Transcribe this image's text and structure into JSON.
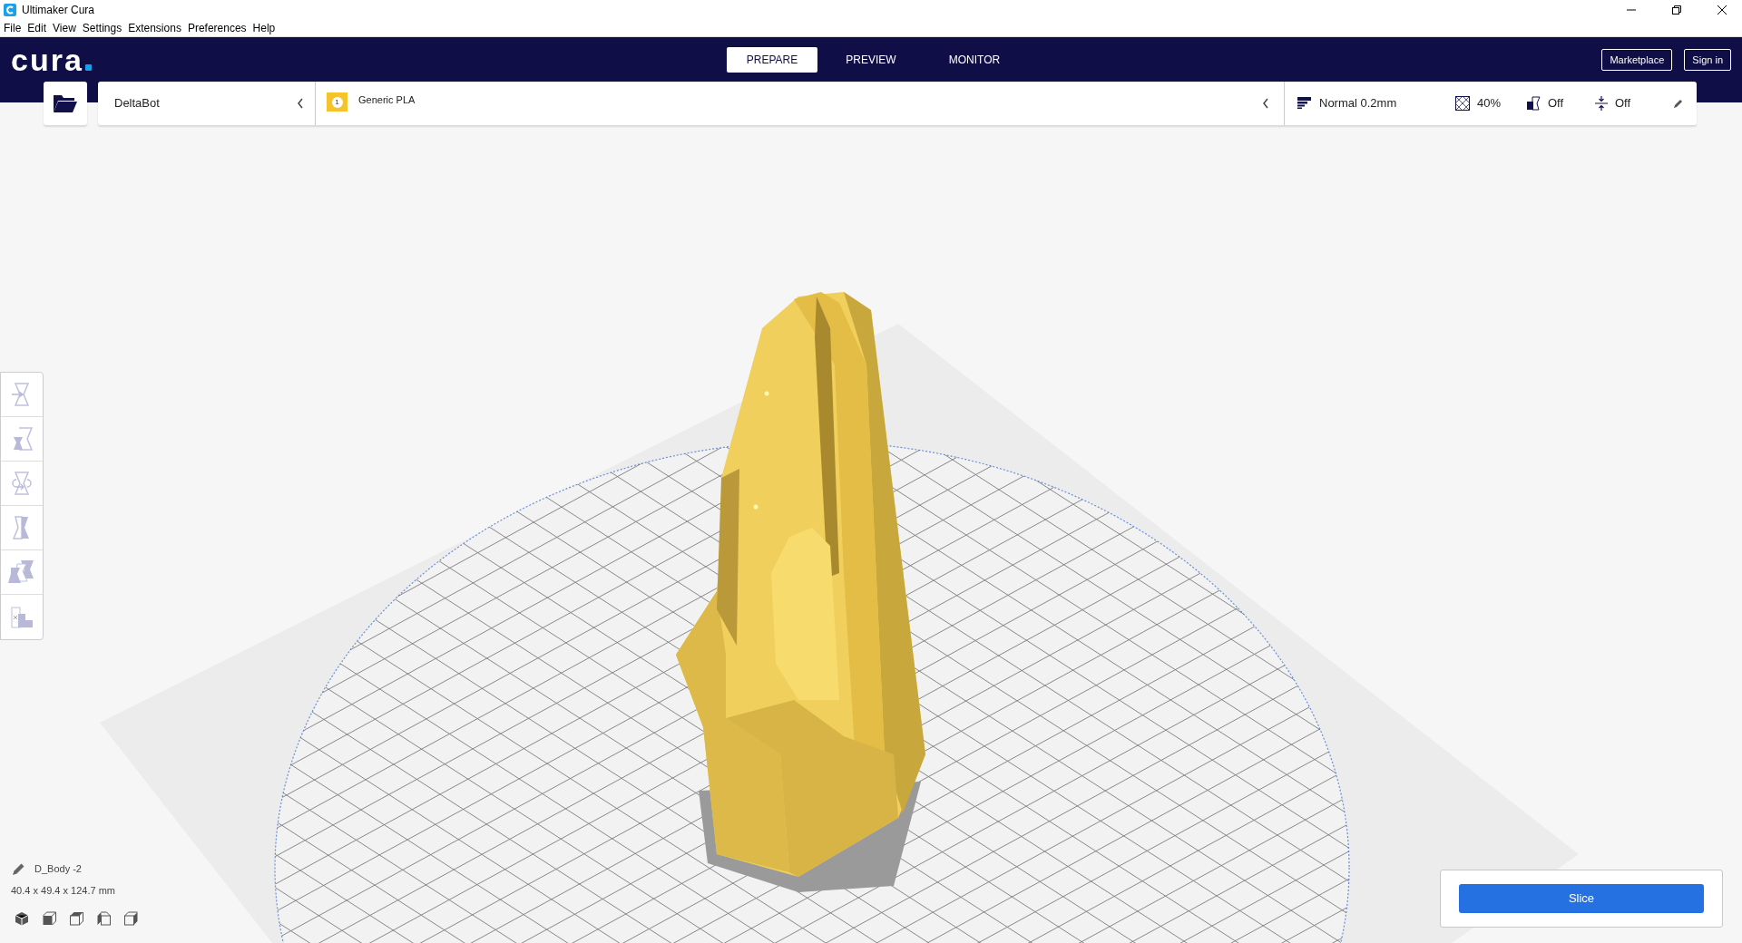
{
  "window": {
    "title": "Ultimaker Cura"
  },
  "menu": [
    "File",
    "Edit",
    "View",
    "Settings",
    "Extensions",
    "Preferences",
    "Help"
  ],
  "header": {
    "logo": "cura",
    "tabs": [
      {
        "label": "PREPARE",
        "selected": true
      },
      {
        "label": "PREVIEW",
        "selected": false
      },
      {
        "label": "MONITOR",
        "selected": false
      }
    ],
    "buttons": [
      "Marketplace",
      "Sign in"
    ]
  },
  "toolbar": {
    "printer": "DeltaBot",
    "material": {
      "extruder": "1",
      "name": "Generic PLA"
    },
    "profile": "Normal 0.2mm",
    "infill": "40%",
    "support": "Off",
    "adhesion": "Off"
  },
  "object": {
    "name": "D_Body -2",
    "dimensions": "40.4 x 49.4 x 124.7 mm"
  },
  "slice_button": "Slice"
}
